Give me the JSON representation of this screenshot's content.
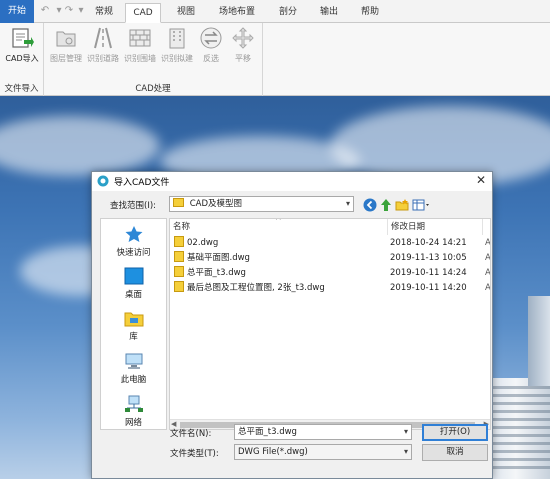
{
  "ribbon": {
    "start_label": "开始",
    "tabs": [
      "常规",
      "CAD",
      "视图",
      "场地布置",
      "剖分",
      "输出",
      "帮助"
    ],
    "active_tab": "CAD",
    "groups": {
      "file_import": {
        "label": "文件导入",
        "buttons": [
          {
            "label": "CAD导入",
            "icon": "cad-import-icon"
          }
        ]
      },
      "cad_process": {
        "label": "CAD处理",
        "buttons": [
          {
            "label": "图层管理",
            "icon": "layer-manage-icon"
          },
          {
            "label": "识别道路",
            "icon": "road-recognize-icon"
          },
          {
            "label": "识别围墙",
            "icon": "wall-recognize-icon"
          },
          {
            "label": "识别拟建",
            "icon": "building-recognize-icon"
          },
          {
            "label": "反选",
            "icon": "invert-select-icon"
          },
          {
            "label": "平移",
            "icon": "move-icon"
          }
        ]
      }
    }
  },
  "dialog": {
    "title": "导入CAD文件",
    "close": "✕",
    "look_in_label": "查找范围(I):",
    "look_in_value": "CAD及模型图",
    "places": [
      "快速访问",
      "桌面",
      "库",
      "此电脑",
      "网络"
    ],
    "columns": {
      "name": "名称",
      "date": "修改日期"
    },
    "files": [
      {
        "name": "02.dwg",
        "date": "2018-10-24 14:21",
        "extra": "A"
      },
      {
        "name": "基础平面图.dwg",
        "date": "2019-11-13 10:05",
        "extra": "A"
      },
      {
        "name": "总平面_t3.dwg",
        "date": "2019-10-11 14:24",
        "extra": "A"
      },
      {
        "name": "最后总图及工程位置图, 2张_t3.dwg",
        "date": "2019-10-11 14:20",
        "extra": "A"
      }
    ],
    "filename_label": "文件名(N):",
    "filename_value": "总平面_t3.dwg",
    "filetype_label": "文件类型(T):",
    "filetype_value": "DWG File(*.dwg)",
    "open_button": "打开(O)",
    "cancel_button": "取消"
  }
}
